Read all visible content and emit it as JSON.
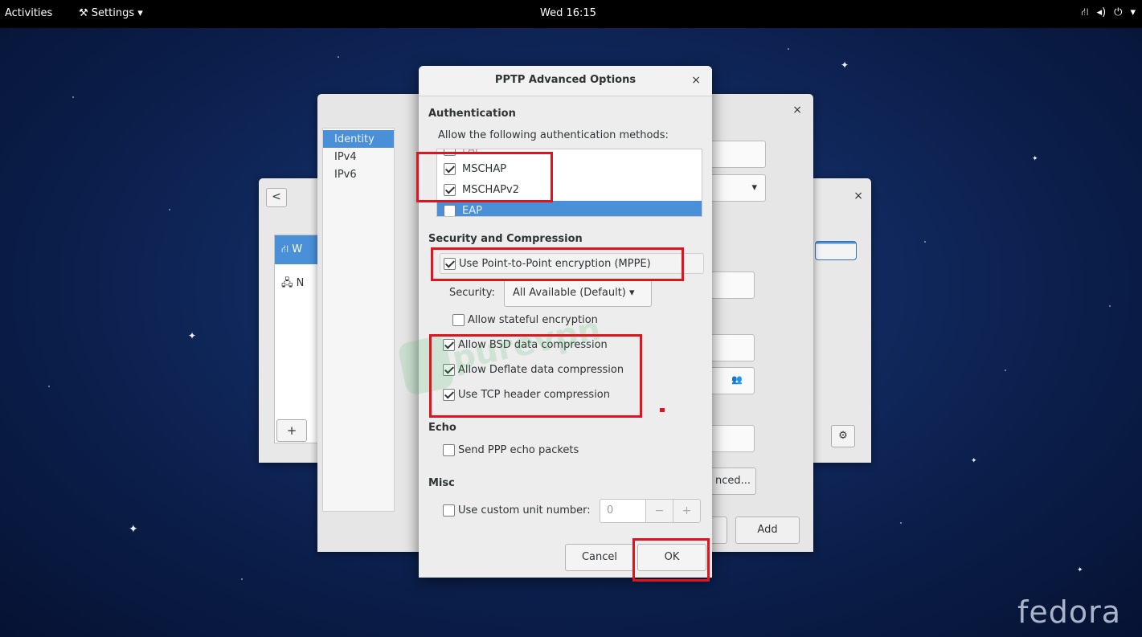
{
  "topbar": {
    "activities": "Activities",
    "app_menu": "Settings",
    "app_icon": "wrench-screwdriver-icon",
    "clock": "Wed 16:15",
    "system_icons": [
      "network-icon",
      "volume-icon",
      "power-icon",
      "chevron-down-icon"
    ]
  },
  "desktop": {
    "logo": "fedora",
    "background_color": "#0f2658"
  },
  "settings_window": {
    "back_glyph": "<",
    "close_glyph": "×",
    "network_rows": [
      "W",
      "N"
    ],
    "add_glyph": "+"
  },
  "vpn_dialog": {
    "close_glyph": "×",
    "sidebar": [
      "Identity",
      "IPv4",
      "IPv6"
    ],
    "advanced_partial": "nced...",
    "add_button": "Add"
  },
  "pptp_dialog": {
    "title": "PPTP Advanced Options",
    "close_glyph": "×",
    "authentication": {
      "heading": "Authentication",
      "prompt": "Allow the following authentication methods:",
      "methods": [
        {
          "label": "PAP",
          "checked": false,
          "selected": false
        },
        {
          "label": "MSCHAP",
          "checked": true,
          "selected": false
        },
        {
          "label": "MSCHAPv2",
          "checked": true,
          "selected": false
        },
        {
          "label": "EAP",
          "checked": false,
          "selected": true
        }
      ]
    },
    "security_compression": {
      "heading": "Security and Compression",
      "use_mppe": {
        "label": "Use Point-to-Point encryption (MPPE)",
        "checked": true
      },
      "security_label": "Security:",
      "security_value": "All Available (Default)",
      "stateful": {
        "label": "Allow stateful encryption",
        "checked": false
      },
      "bsd": {
        "label": "Allow BSD data compression",
        "checked": true
      },
      "deflate": {
        "label": "Allow Deflate data compression",
        "checked": true
      },
      "tcp_header": {
        "label": "Use TCP header compression",
        "checked": true
      }
    },
    "echo": {
      "heading": "Echo",
      "send_echo": {
        "label": "Send PPP echo packets",
        "checked": false
      }
    },
    "misc": {
      "heading": "Misc",
      "custom_unit": {
        "label": "Use custom unit number:",
        "checked": false
      },
      "unit_value": "0",
      "minus": "−",
      "plus": "+"
    },
    "buttons": {
      "cancel": "Cancel",
      "ok": "OK"
    }
  },
  "watermark": {
    "text": "purevpn",
    "color": "#3bb35a"
  },
  "highlight_color": "#e0141e"
}
